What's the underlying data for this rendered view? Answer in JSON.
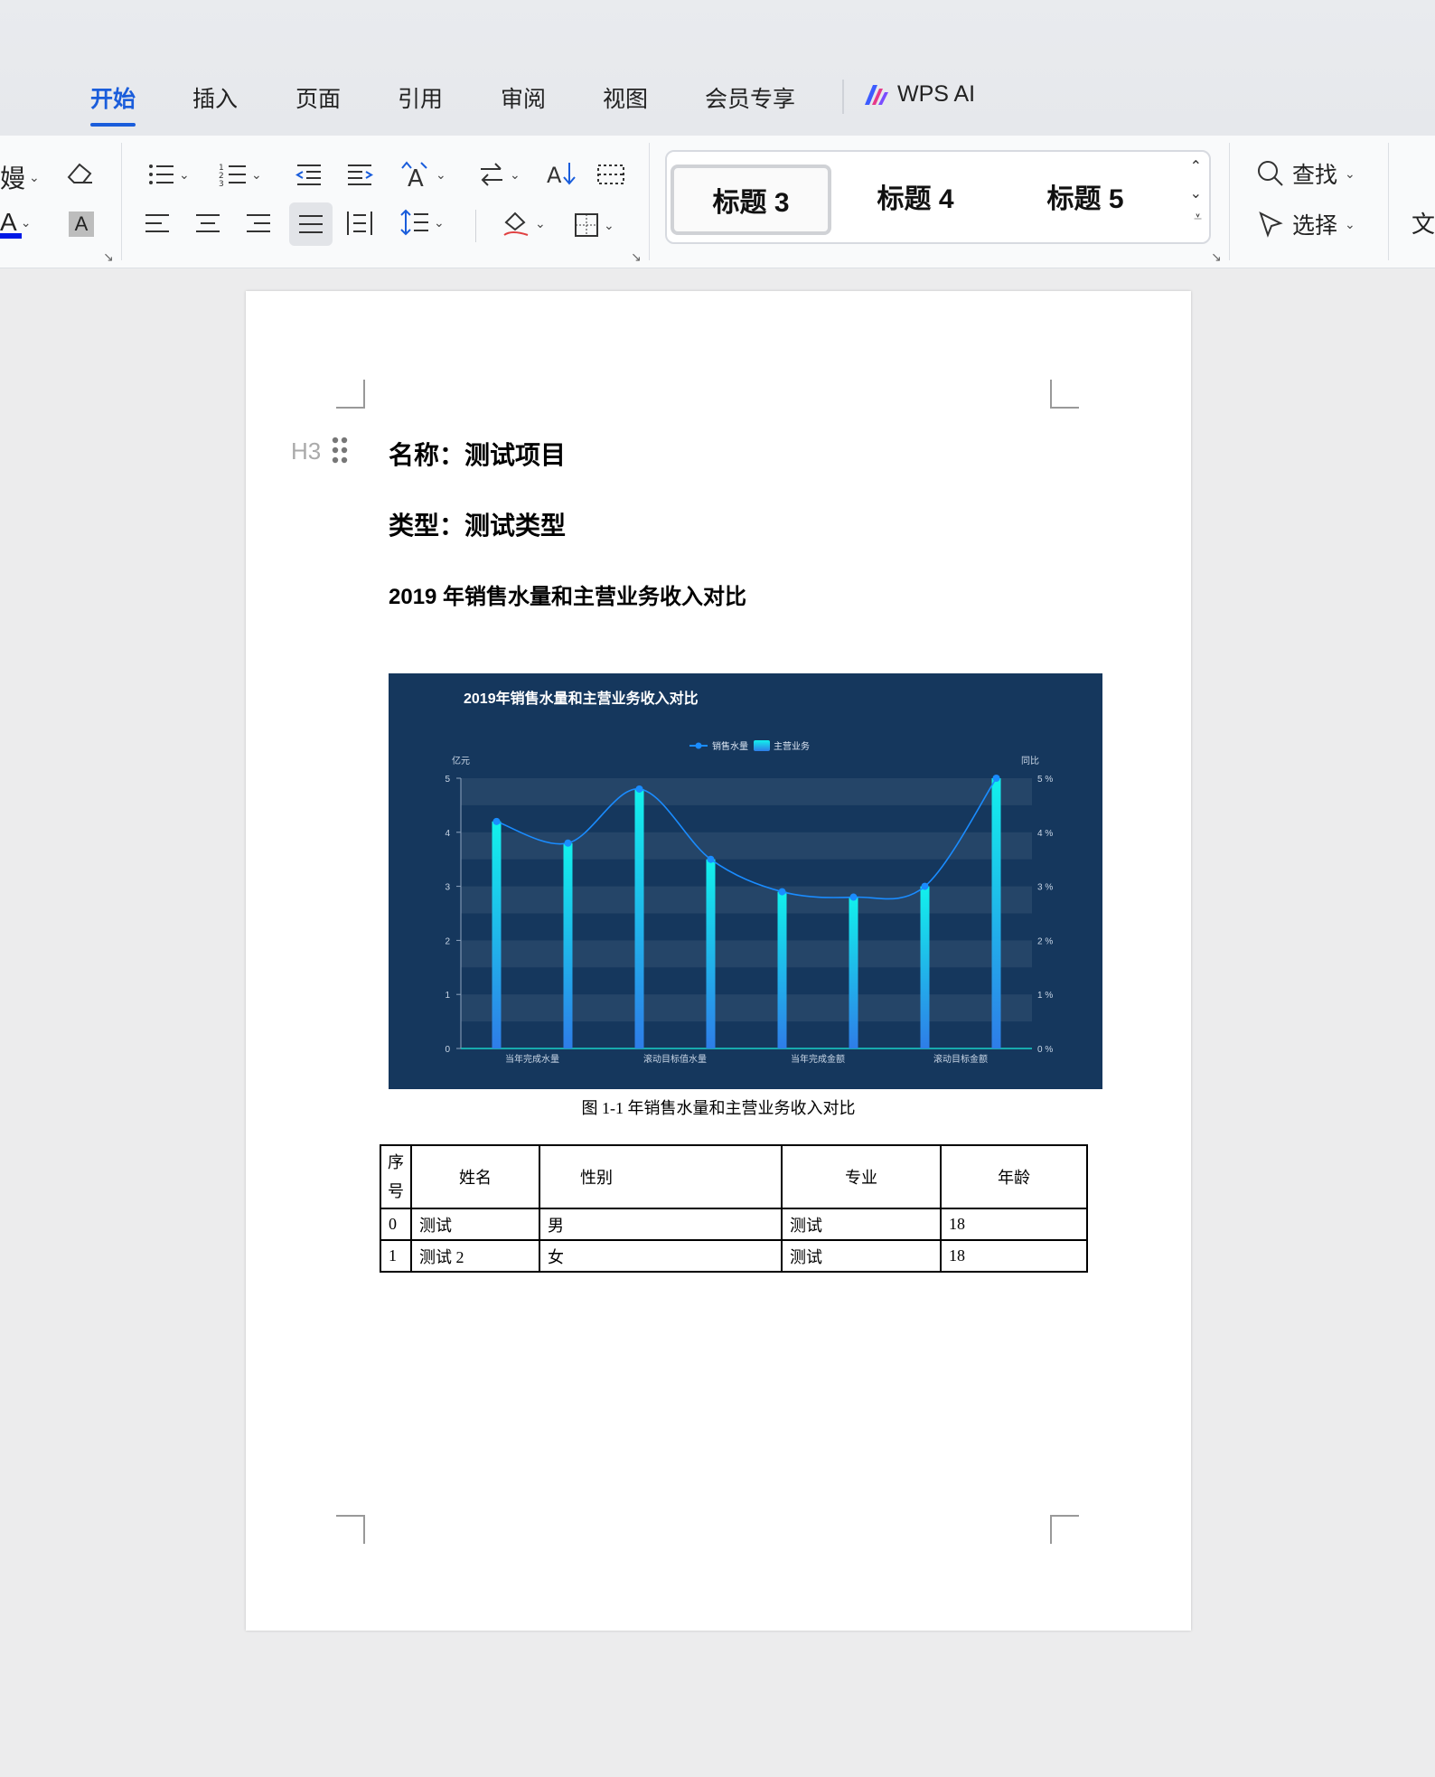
{
  "ribbon_tabs": [
    "开始",
    "插入",
    "页面",
    "引用",
    "审阅",
    "视图",
    "会员专享"
  ],
  "wps_ai_label": "WPS AI",
  "accent_color": "#1a5ddb",
  "style_gallery": [
    "标题 3",
    "标题 4",
    "标题 5"
  ],
  "find_label": "查找",
  "select_label": "选择",
  "partial_right_label": "文",
  "partial_left_glyph": "嫚",
  "font_color_glyph": "A",
  "highlight_glyph": "A",
  "ribbon_icons": [
    "eraser-icon",
    "bulleted-list-icon",
    "numbered-list-icon",
    "decrease-indent-icon",
    "increase-indent-icon",
    "text-direction-icon",
    "swap-icon",
    "sort-icon",
    "table-grid-icon",
    "align-left-icon",
    "align-center-icon",
    "align-right-icon",
    "justify-icon",
    "distributed-icon",
    "line-spacing-icon",
    "shading-icon",
    "border-icon"
  ],
  "document": {
    "heading_marker": "H3",
    "line1": "名称：测试项目",
    "line2": "类型：测试类型",
    "line3": "2019 年销售水量和主营业务收入对比",
    "caption": "图 1-1 年销售水量和主营业务收入对比",
    "table": {
      "headers": [
        "序号",
        "姓名",
        "性别",
        "专业",
        "年龄"
      ],
      "rows": [
        [
          "0",
          "测试",
          "男",
          "测试",
          "18"
        ],
        [
          "1",
          "测试 2",
          "女",
          "测试",
          "18"
        ]
      ]
    }
  },
  "chart_data": {
    "type": "bar",
    "title": "2019年销售水量和主营业务收入对比",
    "legend": [
      "销售水量",
      "主营业务"
    ],
    "legend_position": "top-center",
    "y_left_label": "亿元",
    "y_right_label": "同比",
    "ylim": [
      0,
      5
    ],
    "y_left_ticks": [
      "0",
      "1",
      "2",
      "3",
      "4",
      "5"
    ],
    "y_right_ticks": [
      "0 %",
      "1 %",
      "2 %",
      "3 %",
      "4 %",
      "5 %"
    ],
    "x_tick_labels": [
      "当年完成水量",
      "滚动目标值水量",
      "当年完成金额",
      "滚动目标金额"
    ],
    "x": [
      1,
      2,
      3,
      4,
      5,
      6,
      7,
      8
    ],
    "series": [
      {
        "name": "主营业务",
        "type": "bar",
        "values": [
          4.2,
          3.8,
          4.8,
          3.5,
          2.9,
          2.8,
          3.0,
          5.0
        ]
      },
      {
        "name": "销售水量",
        "type": "line",
        "values": [
          4.2,
          3.8,
          4.8,
          3.5,
          2.9,
          2.8,
          3.0,
          5.0
        ]
      }
    ],
    "background_color": "#15375d",
    "bar_color_top": "#12f1ec",
    "bar_color_bottom": "#2e7de8",
    "line_color": "#1a8cff"
  }
}
